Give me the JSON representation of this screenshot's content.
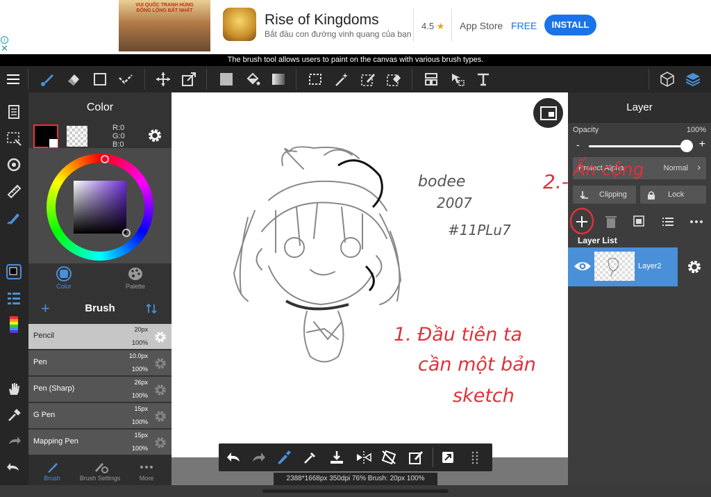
{
  "ad": {
    "info_glyph": "i",
    "close_glyph": "✕",
    "image_caption": "VUI QUỐC TRANH HÙNG ĐÔNG LỘNG BẤT NHẤT",
    "title": "Rise of Kingdoms",
    "subtitle": "Bắt đầu con đường vinh quang của bạn",
    "rating": "4.5",
    "star": "★",
    "store": "App Store",
    "price": "FREE",
    "install": "INSTALL"
  },
  "tooltip": "The brush tool allows users to paint on the canvas with various brush types.",
  "color_panel": {
    "title": "Color",
    "rgb": [
      "R:0",
      "G:0",
      "B:0"
    ],
    "tabs": [
      "Color",
      "Palette"
    ]
  },
  "brush_panel": {
    "title": "Brush",
    "add": "+",
    "items": [
      {
        "name": "Pencil",
        "size": "20px",
        "opacity": "100%"
      },
      {
        "name": "Pen",
        "size": "10.0px",
        "opacity": "100%"
      },
      {
        "name": "Pen (Sharp)",
        "size": "26px",
        "opacity": "100%"
      },
      {
        "name": "G Pen",
        "size": "15px",
        "opacity": "100%"
      },
      {
        "name": "Mapping Pen",
        "size": "15px",
        "opacity": "100%"
      }
    ],
    "tabs": [
      "Brush",
      "Brush Settings",
      "More"
    ]
  },
  "layer_panel": {
    "title": "Layer",
    "opacity_label": "Opacity",
    "opacity_value": "100%",
    "opacity_fraction": 1.0,
    "minus": "-",
    "plus": "+",
    "protect_alpha": "Protect Alpha",
    "blend_mode": "Normal",
    "chevron": "›",
    "clipping": "Clipping",
    "lock": "Lock",
    "layer_list_title": "Layer List",
    "layer_name": "Layer2"
  },
  "canvas": {
    "sketch_text": [
      "bodee",
      "2007",
      "#11PLu7"
    ],
    "annotation_1": [
      "1. Đầu tiên ta",
      "cần một bản",
      "sketch"
    ],
    "annotation_2_number": "2.-",
    "annotation_2_text": "Ấn cộng"
  },
  "status_bar": "2388*1668px 350dpi 76% Brush: 20px 100%",
  "colors": {
    "accent": "#4a90d9",
    "annotation": "#e0313a",
    "install": "#1a73e8"
  }
}
